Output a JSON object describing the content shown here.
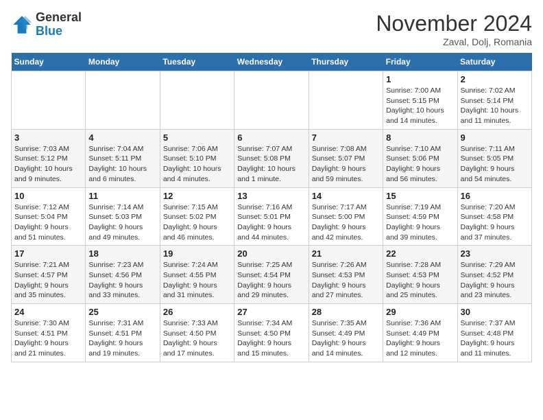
{
  "header": {
    "logo": {
      "line1": "General",
      "line2": "Blue"
    },
    "title": "November 2024",
    "location": "Zaval, Dolj, Romania"
  },
  "weekdays": [
    "Sunday",
    "Monday",
    "Tuesday",
    "Wednesday",
    "Thursday",
    "Friday",
    "Saturday"
  ],
  "weeks": [
    [
      {
        "day": "",
        "info": ""
      },
      {
        "day": "",
        "info": ""
      },
      {
        "day": "",
        "info": ""
      },
      {
        "day": "",
        "info": ""
      },
      {
        "day": "",
        "info": ""
      },
      {
        "day": "1",
        "info": "Sunrise: 7:00 AM\nSunset: 5:15 PM\nDaylight: 10 hours\nand 14 minutes."
      },
      {
        "day": "2",
        "info": "Sunrise: 7:02 AM\nSunset: 5:14 PM\nDaylight: 10 hours\nand 11 minutes."
      }
    ],
    [
      {
        "day": "3",
        "info": "Sunrise: 7:03 AM\nSunset: 5:12 PM\nDaylight: 10 hours\nand 9 minutes."
      },
      {
        "day": "4",
        "info": "Sunrise: 7:04 AM\nSunset: 5:11 PM\nDaylight: 10 hours\nand 6 minutes."
      },
      {
        "day": "5",
        "info": "Sunrise: 7:06 AM\nSunset: 5:10 PM\nDaylight: 10 hours\nand 4 minutes."
      },
      {
        "day": "6",
        "info": "Sunrise: 7:07 AM\nSunset: 5:08 PM\nDaylight: 10 hours\nand 1 minute."
      },
      {
        "day": "7",
        "info": "Sunrise: 7:08 AM\nSunset: 5:07 PM\nDaylight: 9 hours\nand 59 minutes."
      },
      {
        "day": "8",
        "info": "Sunrise: 7:10 AM\nSunset: 5:06 PM\nDaylight: 9 hours\nand 56 minutes."
      },
      {
        "day": "9",
        "info": "Sunrise: 7:11 AM\nSunset: 5:05 PM\nDaylight: 9 hours\nand 54 minutes."
      }
    ],
    [
      {
        "day": "10",
        "info": "Sunrise: 7:12 AM\nSunset: 5:04 PM\nDaylight: 9 hours\nand 51 minutes."
      },
      {
        "day": "11",
        "info": "Sunrise: 7:14 AM\nSunset: 5:03 PM\nDaylight: 9 hours\nand 49 minutes."
      },
      {
        "day": "12",
        "info": "Sunrise: 7:15 AM\nSunset: 5:02 PM\nDaylight: 9 hours\nand 46 minutes."
      },
      {
        "day": "13",
        "info": "Sunrise: 7:16 AM\nSunset: 5:01 PM\nDaylight: 9 hours\nand 44 minutes."
      },
      {
        "day": "14",
        "info": "Sunrise: 7:17 AM\nSunset: 5:00 PM\nDaylight: 9 hours\nand 42 minutes."
      },
      {
        "day": "15",
        "info": "Sunrise: 7:19 AM\nSunset: 4:59 PM\nDaylight: 9 hours\nand 39 minutes."
      },
      {
        "day": "16",
        "info": "Sunrise: 7:20 AM\nSunset: 4:58 PM\nDaylight: 9 hours\nand 37 minutes."
      }
    ],
    [
      {
        "day": "17",
        "info": "Sunrise: 7:21 AM\nSunset: 4:57 PM\nDaylight: 9 hours\nand 35 minutes."
      },
      {
        "day": "18",
        "info": "Sunrise: 7:23 AM\nSunset: 4:56 PM\nDaylight: 9 hours\nand 33 minutes."
      },
      {
        "day": "19",
        "info": "Sunrise: 7:24 AM\nSunset: 4:55 PM\nDaylight: 9 hours\nand 31 minutes."
      },
      {
        "day": "20",
        "info": "Sunrise: 7:25 AM\nSunset: 4:54 PM\nDaylight: 9 hours\nand 29 minutes."
      },
      {
        "day": "21",
        "info": "Sunrise: 7:26 AM\nSunset: 4:53 PM\nDaylight: 9 hours\nand 27 minutes."
      },
      {
        "day": "22",
        "info": "Sunrise: 7:28 AM\nSunset: 4:53 PM\nDaylight: 9 hours\nand 25 minutes."
      },
      {
        "day": "23",
        "info": "Sunrise: 7:29 AM\nSunset: 4:52 PM\nDaylight: 9 hours\nand 23 minutes."
      }
    ],
    [
      {
        "day": "24",
        "info": "Sunrise: 7:30 AM\nSunset: 4:51 PM\nDaylight: 9 hours\nand 21 minutes."
      },
      {
        "day": "25",
        "info": "Sunrise: 7:31 AM\nSunset: 4:51 PM\nDaylight: 9 hours\nand 19 minutes."
      },
      {
        "day": "26",
        "info": "Sunrise: 7:33 AM\nSunset: 4:50 PM\nDaylight: 9 hours\nand 17 minutes."
      },
      {
        "day": "27",
        "info": "Sunrise: 7:34 AM\nSunset: 4:50 PM\nDaylight: 9 hours\nand 15 minutes."
      },
      {
        "day": "28",
        "info": "Sunrise: 7:35 AM\nSunset: 4:49 PM\nDaylight: 9 hours\nand 14 minutes."
      },
      {
        "day": "29",
        "info": "Sunrise: 7:36 AM\nSunset: 4:49 PM\nDaylight: 9 hours\nand 12 minutes."
      },
      {
        "day": "30",
        "info": "Sunrise: 7:37 AM\nSunset: 4:48 PM\nDaylight: 9 hours\nand 11 minutes."
      }
    ]
  ]
}
